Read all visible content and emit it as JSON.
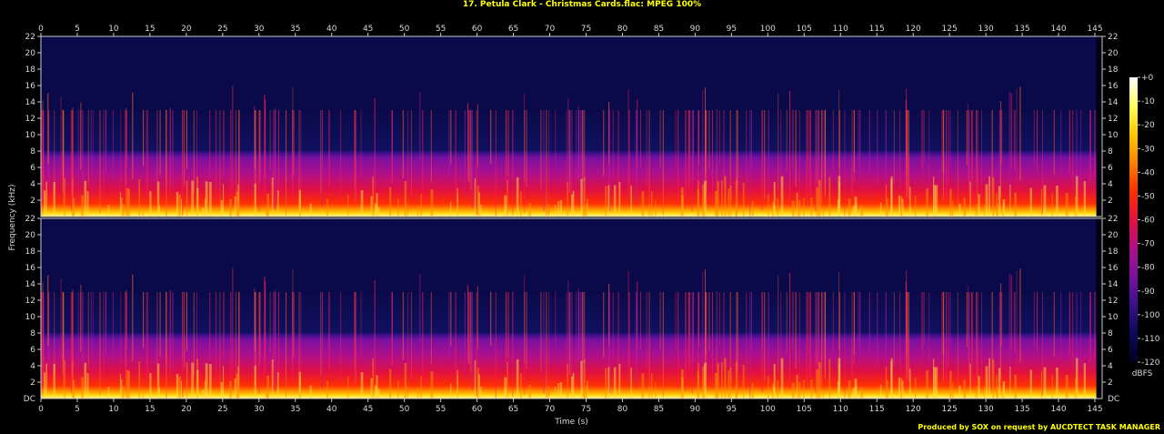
{
  "chart_data": {
    "type": "heatmap",
    "title": "17. Petula Clark - Christmas Cards.flac: MPEG 100%",
    "xlabel": "Time (s)",
    "ylabel": "Frequency (kHz)",
    "xlim": [
      0,
      146
    ],
    "x_ticks": [
      0,
      5,
      10,
      15,
      20,
      25,
      30,
      35,
      40,
      45,
      50,
      55,
      60,
      65,
      70,
      75,
      80,
      85,
      90,
      95,
      100,
      105,
      110,
      115,
      120,
      125,
      130,
      135,
      140,
      145
    ],
    "channels": [
      {
        "name": "",
        "ylim": [
          0,
          22
        ],
        "y_ticks": [
          "2",
          "4",
          "6",
          "8",
          "10",
          "12",
          "14",
          "16",
          "18",
          "20",
          "22"
        ],
        "bottom_label": ""
      },
      {
        "name": "",
        "ylim": [
          0,
          22
        ],
        "y_ticks": [
          "2",
          "4",
          "6",
          "8",
          "10",
          "12",
          "14",
          "16",
          "18",
          "20",
          "22"
        ],
        "bottom_label": "DC"
      }
    ],
    "frequency_cutoff_khz": 13,
    "colorbar": {
      "label": "dBFS",
      "ticks": [
        "+0",
        "-10",
        "-20",
        "-30",
        "-40",
        "-50",
        "-60",
        "-70",
        "-80",
        "-90",
        "-100",
        "-110",
        "-120"
      ],
      "range": [
        -120,
        0
      ],
      "colors": [
        "#000020",
        "#0a0a5a",
        "#3a108a",
        "#7a10a0",
        "#b0108a",
        "#e01040",
        "#ff3000",
        "#ff8000",
        "#ffc800",
        "#ffff60",
        "#ffffff"
      ]
    }
  },
  "footer": "Produced by SOX on request by AUCDTECT TASK MANAGER"
}
